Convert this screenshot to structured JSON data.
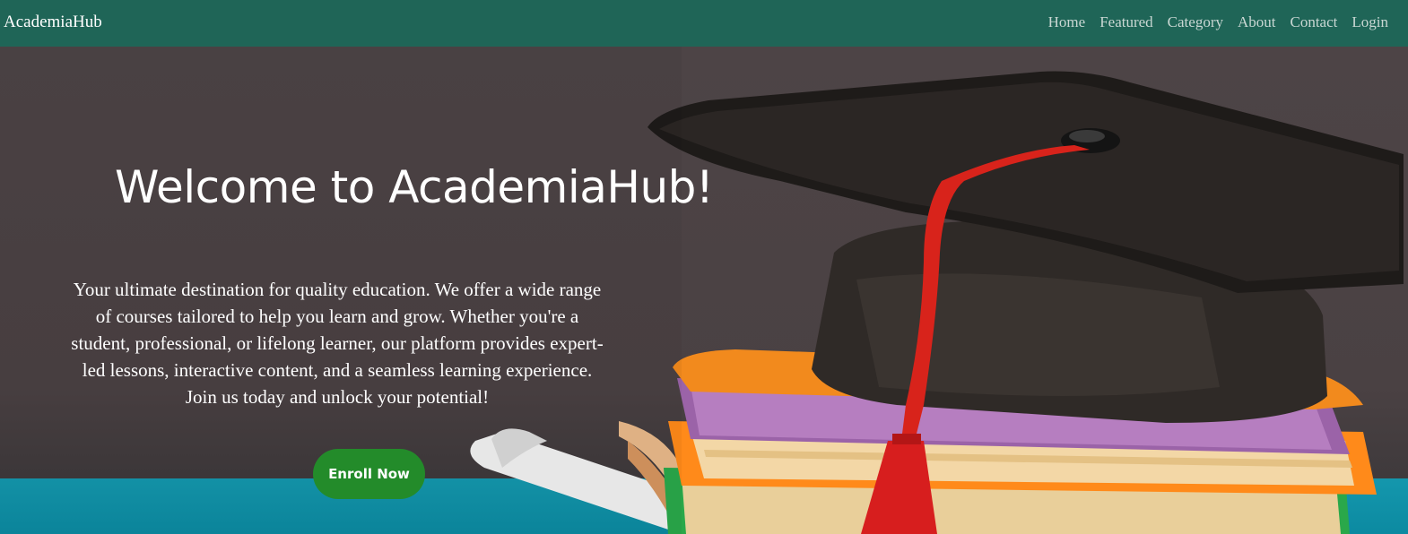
{
  "header": {
    "brand": "AcademiaHub",
    "nav": [
      {
        "label": "Home"
      },
      {
        "label": "Featured"
      },
      {
        "label": "Category"
      },
      {
        "label": "About"
      },
      {
        "label": "Contact"
      },
      {
        "label": "Login"
      }
    ]
  },
  "hero": {
    "title": "Welcome to AcademiaHub!",
    "description": "Your ultimate destination for quality education. We offer a wide range of courses tailored to help you learn and grow. Whether you're a student, professional, or lifelong learner, our platform provides expert-led lessons, interactive content, and a seamless learning experience. Join us today and unlock your potential!",
    "cta_label": "Enroll Now"
  },
  "colors": {
    "navbar": "#1f6557",
    "cta": "#238b2a",
    "hero_bg": "#4d4446",
    "floor": "#0c8aa1"
  },
  "icons": {
    "hero_image": "graduation-cap-books-image"
  }
}
